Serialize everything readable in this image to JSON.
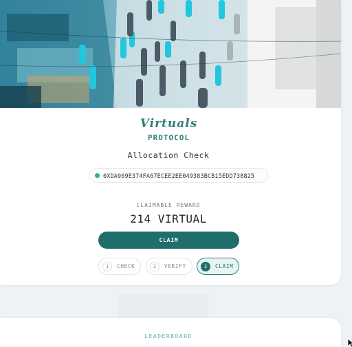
{
  "hero": {
    "image": "anime-style illustration of a busy street market with cyan-highlighted people"
  },
  "logo": {
    "script_text": "Virtuals",
    "sub_text": "PROTOCOL"
  },
  "title": "Allocation Check",
  "wallet": {
    "address": "0XDA969E374FA67ECEE2EE049383BCB15EDD738825",
    "status_color": "#2bb673"
  },
  "reward": {
    "label": "CLAIMABLE REWARD",
    "value": "214 VIRTUAL"
  },
  "claim_button": {
    "label": "CLAIM"
  },
  "steps": [
    {
      "num": "1",
      "label": "CHECK",
      "active": false
    },
    {
      "num": "2",
      "label": "VERIFY",
      "active": false
    },
    {
      "num": "3",
      "label": "CLAIM",
      "active": true
    }
  ],
  "leaderboard": {
    "title": "LEADERBOARD"
  },
  "colors": {
    "accent": "#1f6e6b",
    "logo": "#2f7f76",
    "background": "#eef2f4"
  }
}
